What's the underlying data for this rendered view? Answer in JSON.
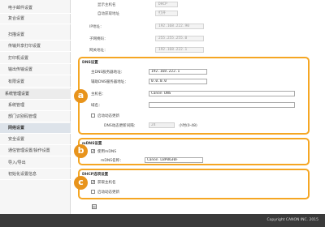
{
  "sidebar": {
    "items": [
      {
        "label": "电子邮件设置"
      },
      {
        "label": "复合设置"
      },
      {
        "label": "扫描设置"
      },
      {
        "label": "传输共享打印设置"
      },
      {
        "label": "打印机设置"
      },
      {
        "label": "输出传输设置"
      },
      {
        "label": "有限设置"
      },
      {
        "label": "系统管理设置"
      },
      {
        "label": "系统管理"
      },
      {
        "label": "部门识别码管理"
      },
      {
        "label": "网络设置"
      },
      {
        "label": "安全设置"
      },
      {
        "label": "通信管理设置/操作设置"
      },
      {
        "label": "导入/导出"
      },
      {
        "label": "初始化设置信息"
      }
    ]
  },
  "top": {
    "row1_label": "显示主机名",
    "row1_value": "DHCP",
    "row2_label": "自动获取地址",
    "row2_value": "打开",
    "ip_label": "IP地址：",
    "ip_value": "192.168.222.90",
    "mask_label": "子网掩码：",
    "mask_value": "255.255.255.0",
    "gateway_label": "网关地址：",
    "gateway_value": "192.168.222.1"
  },
  "dns": {
    "title": "DNS设置",
    "primary_label": "主DNS服务器地址：",
    "primary_value": "192.168.222.1",
    "secondary_label": "辅助DNS服务器地址：",
    "secondary_value": "0.0.0.0",
    "host_label": "主机名：",
    "host_value": "Canon DNS",
    "domain_label": "域名：",
    "domain_value": "",
    "dynamic_label": "启动动态更新",
    "interval_label": "DNS动态更新间隔：",
    "interval_value": "24",
    "interval_unit": "小时(0-48)"
  },
  "mdns": {
    "title": "mDNS设置",
    "enable_label": "使用mDNS",
    "name_label": "mDNS名称：",
    "name_value": "Canon LBP8630F"
  },
  "dhcp": {
    "title": "DHCP选项设置",
    "host_label": "获取主机名",
    "dynamic_label": "启动动态更新"
  },
  "badges": {
    "a": "a",
    "b": "b",
    "c": "c"
  },
  "footer": {
    "copyright": "Copyright CANON INC. 2015"
  },
  "colors": {
    "accent": "#f5a623",
    "badge": "#e8941c",
    "footer": "#3a3a3a"
  }
}
